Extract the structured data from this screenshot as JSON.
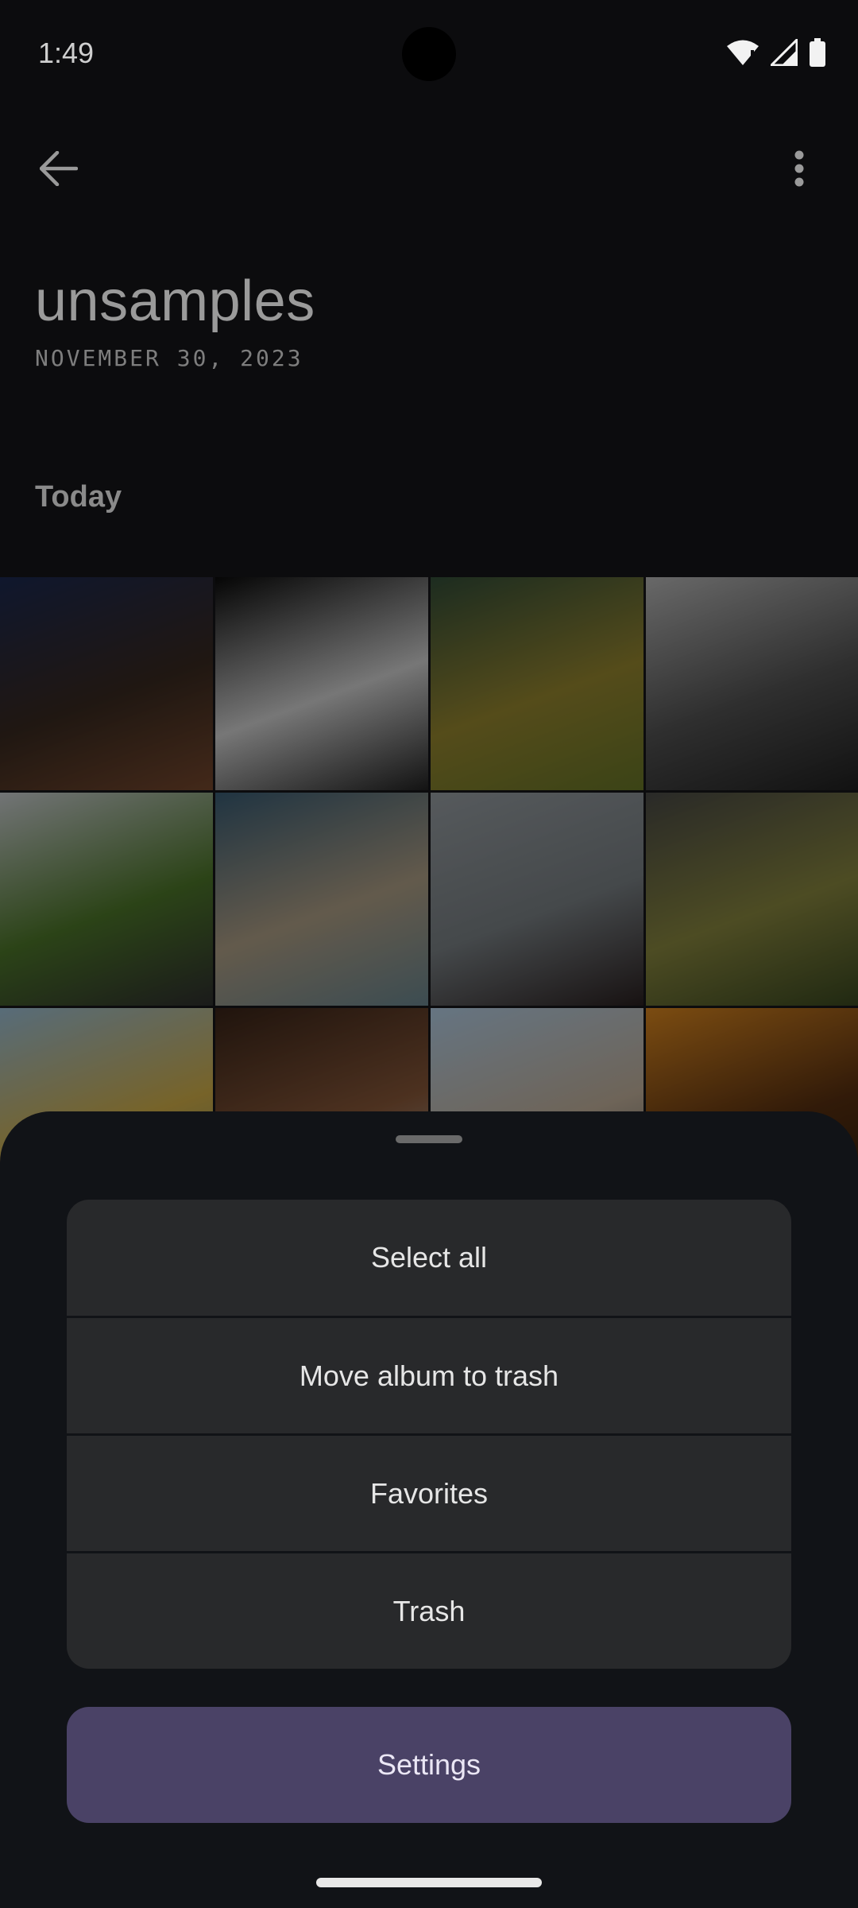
{
  "status_bar": {
    "time": "1:49",
    "icons": [
      "wifi-icon",
      "signal-icon",
      "battery-icon"
    ]
  },
  "toolbar": {
    "back_icon": "arrow-left-icon",
    "more_icon": "more-vert-icon"
  },
  "album": {
    "title": "unsamples",
    "date": "NOVEMBER 30, 2023"
  },
  "section": {
    "title": "Today"
  },
  "photos": [
    {
      "name": "night-desert-rocks",
      "colors": [
        "#1c2a52",
        "#3a2a20",
        "#7a4a2e"
      ]
    },
    {
      "name": "concert-musicians",
      "colors": [
        "#0a0a0a",
        "#d8d8d8",
        "#222"
      ]
    },
    {
      "name": "mossy-tree-trunk",
      "colors": [
        "#34503a",
        "#9a8a30",
        "#6b7a28"
      ]
    },
    {
      "name": "city-fog-skyline",
      "colors": [
        "#bdbdbd",
        "#555",
        "#202020"
      ]
    },
    {
      "name": "mountain-road",
      "colors": [
        "#cfd3d6",
        "#4f7a2a",
        "#303030"
      ]
    },
    {
      "name": "beach-sun",
      "colors": [
        "#3b5f77",
        "#b4a48a",
        "#6d8a94"
      ]
    },
    {
      "name": "man-walking-street",
      "colors": [
        "#9ca3a8",
        "#7d8488",
        "#2a2020"
      ]
    },
    {
      "name": "green-valley-clouds",
      "colors": [
        "#4c4c48",
        "#8c8a40",
        "#3b4a20"
      ]
    },
    {
      "name": "colorful-houses",
      "colors": [
        "#9fc4dc",
        "#d8b44a",
        "#6e8a74"
      ]
    },
    {
      "name": "tools-on-wood",
      "colors": [
        "#3a2418",
        "#8c5a3a",
        "#bfbfbf"
      ]
    },
    {
      "name": "winter-trees-sky",
      "colors": [
        "#b9d4ec",
        "#c8b6a0",
        "#555"
      ]
    },
    {
      "name": "golden-grass-sunset",
      "colors": [
        "#e08a20",
        "#5a3010",
        "#2a1a08"
      ]
    }
  ],
  "sheet": {
    "menu_items": [
      "Select all",
      "Move album to trash",
      "Favorites",
      "Trash"
    ],
    "settings_label": "Settings"
  },
  "colors": {
    "background": "#0c0c0e",
    "sheet": "#111317",
    "menu_item": "#28292b",
    "settings_button": "#4a4266"
  }
}
